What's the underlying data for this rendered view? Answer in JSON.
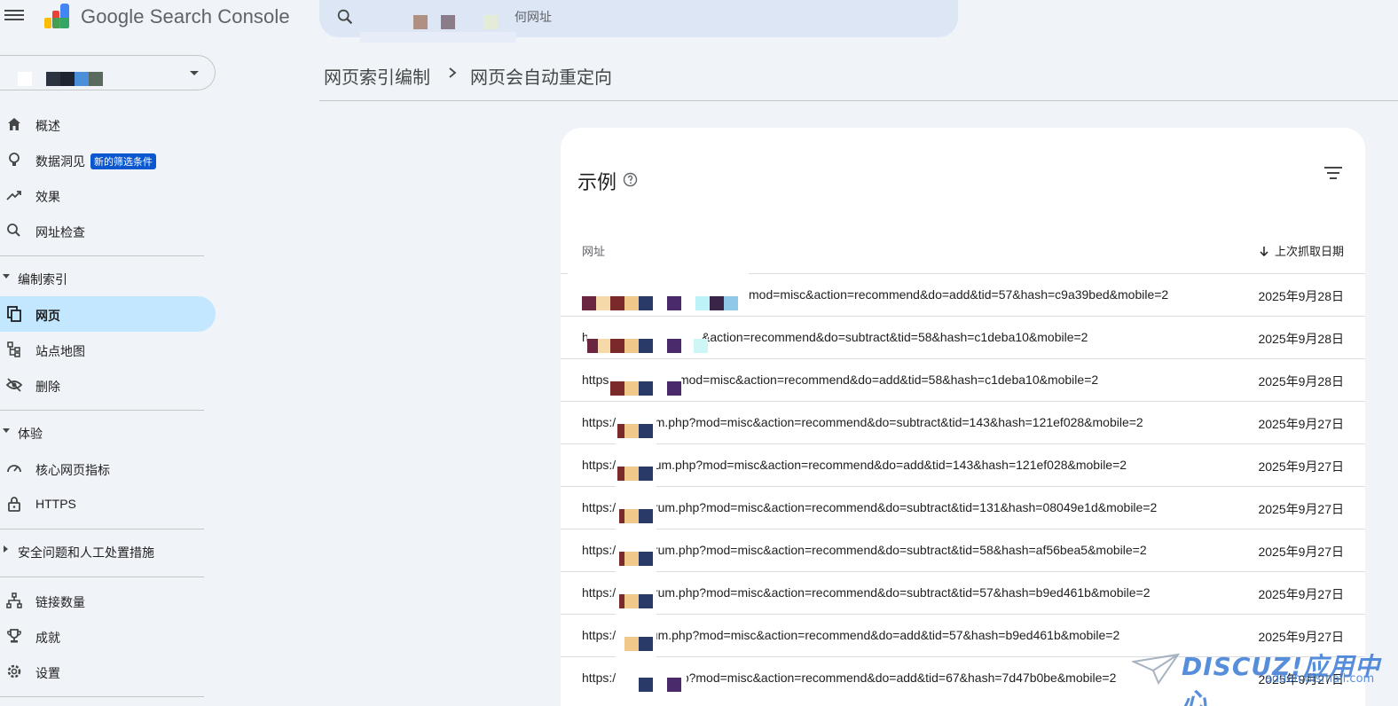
{
  "header": {
    "brand": "Google Search Console",
    "search_placeholder": "何网址"
  },
  "sidebar": {
    "items_top": [
      {
        "label": "概述",
        "icon": "home-icon"
      },
      {
        "label": "数据洞见",
        "icon": "lightbulb-icon",
        "badge": "新的筛选条件"
      },
      {
        "label": "效果",
        "icon": "trending-up-icon"
      },
      {
        "label": "网址检查",
        "icon": "search-icon"
      }
    ],
    "section_index": "编制索引",
    "items_index": [
      {
        "label": "网页",
        "icon": "pages-icon"
      },
      {
        "label": "站点地图",
        "icon": "sitemap-icon"
      },
      {
        "label": "删除",
        "icon": "eye-off-icon"
      }
    ],
    "section_experience": "体验",
    "items_experience": [
      {
        "label": "核心网页指标",
        "icon": "speed-icon"
      },
      {
        "label": "HTTPS",
        "icon": "lock-icon"
      }
    ],
    "section_security": "安全问题和人工处置措施",
    "items_bottom": [
      {
        "label": "链接数量",
        "icon": "links-icon"
      },
      {
        "label": "成就",
        "icon": "trophy-icon"
      },
      {
        "label": "设置",
        "icon": "gear-icon"
      }
    ]
  },
  "breadcrumb": {
    "parent": "网页索引编制",
    "current": "网页会自动重定向"
  },
  "card": {
    "title": "示例",
    "col_url": "网址",
    "col_date": "上次抓取日期",
    "rows": [
      {
        "url": "mod=misc&action=recommend&do=add&tid=57&hash=c9a39bed&mobile=2",
        "date": "2025年9月28日"
      },
      {
        "url": "h           rum.php?mod=misc&action=recommend&do=subtract&tid=58&hash=c1deba10&mobile=2",
        "date": "2025年9月28日"
      },
      {
        "url": "https              /forum.php?mod=misc&action=recommend&do=add&tid=58&hash=c1deba10&mobile=2",
        "date": "2025年9月28日"
      },
      {
        "url": "https:/           m/forum.php?mod=misc&action=recommend&do=subtract&tid=143&hash=121ef028&mobile=2",
        "date": "2025年9月27日"
      },
      {
        "url": "https:/           om/forum.php?mod=misc&action=recommend&do=add&tid=143&hash=121ef028&mobile=2",
        "date": "2025年9月27日"
      },
      {
        "url": "https://           om/forum.php?mod=misc&action=recommend&do=subtract&tid=131&hash=08049e1d&mobile=2",
        "date": "2025年9月27日"
      },
      {
        "url": "https://           om/forum.php?mod=misc&action=recommend&do=subtract&tid=58&hash=af56bea5&mobile=2",
        "date": "2025年9月27日"
      },
      {
        "url": "https://           om/forum.php?mod=misc&action=recommend&do=subtract&tid=57&hash=b9ed461b&mobile=2",
        "date": "2025年9月27日"
      },
      {
        "url": "https://           m/forum.php?mod=misc&action=recommend&do=add&tid=57&hash=b9ed461b&mobile=2",
        "date": "2025年9月27日"
      },
      {
        "url": "https://ir          /forum.php?mod=misc&action=recommend&do=add&tid=67&hash=7d47b0be&mobile=2",
        "date": "2025年9月27日"
      }
    ]
  },
  "watermark": {
    "line1": "DISCUZ!应用中心",
    "line2": "addon.dismall.com"
  },
  "colors": {
    "background": "#f0f4f9",
    "active_nav": "#c2e7ff",
    "badge": "#0b57d0",
    "search_bg": "#dde6f5"
  }
}
